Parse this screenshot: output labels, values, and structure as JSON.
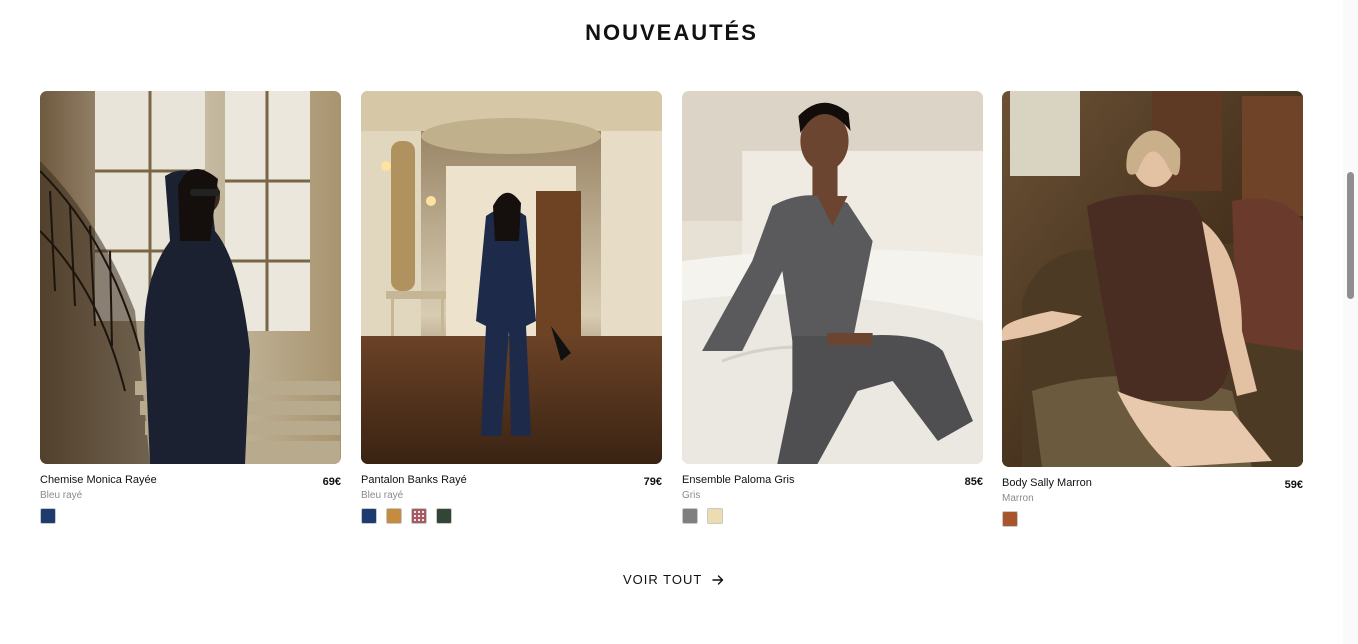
{
  "section": {
    "title": "NOUVEAUTÉS",
    "see_all_label": "VOIR TOUT"
  },
  "products": [
    {
      "name": "Chemise Monica Rayée",
      "price": "69€",
      "color_name": "Bleu rayé",
      "swatches": [
        {
          "color": "#1e3b6f",
          "icon": "solid",
          "selected": true
        }
      ],
      "image": "woman-navy-shirt-staircase"
    },
    {
      "name": "Pantalon Banks Rayé",
      "price": "79€",
      "color_name": "Bleu rayé",
      "swatches": [
        {
          "color": "#1e3b6f",
          "icon": "solid",
          "selected": true
        },
        {
          "color": "#c58b3f",
          "icon": "solid",
          "selected": false
        },
        {
          "color": "#a55b62",
          "icon": "check-pattern",
          "selected": false
        },
        {
          "color": "#334535",
          "icon": "solid",
          "selected": false
        }
      ],
      "image": "woman-navy-suit-hallway"
    },
    {
      "name": "Ensemble Paloma Gris",
      "price": "85€",
      "color_name": "Gris",
      "swatches": [
        {
          "color": "#7f7f7f",
          "icon": "solid",
          "selected": true
        },
        {
          "color": "#ecdcb0",
          "icon": "solid",
          "selected": false
        }
      ],
      "image": "woman-grey-set-bed"
    },
    {
      "name": "Body Sally Marron",
      "price": "59€",
      "color_name": "Marron",
      "swatches": [
        {
          "color": "#a6552d",
          "icon": "solid",
          "selected": true
        }
      ],
      "image": "woman-brown-body-armchair"
    }
  ],
  "colors": {
    "text": "#111111",
    "muted": "#8a8a8a",
    "scroll_thumb": "#8f8f8f"
  }
}
